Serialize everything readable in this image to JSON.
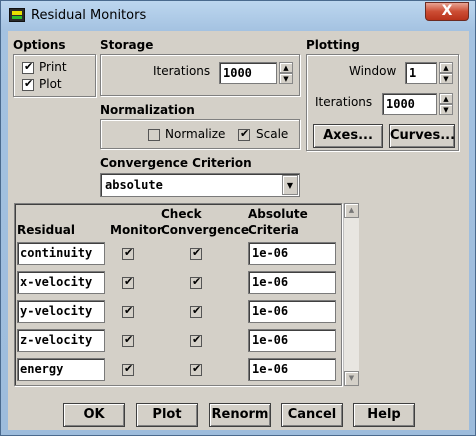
{
  "window": {
    "title": "Residual Monitors",
    "close_label": "X"
  },
  "options": {
    "heading": "Options",
    "print_label": "Print",
    "plot_label": "Plot",
    "print_checked": true,
    "plot_checked": true
  },
  "storage": {
    "heading": "Storage",
    "iterations_label": "Iterations",
    "iterations_value": "1000"
  },
  "plotting": {
    "heading": "Plotting",
    "window_label": "Window",
    "window_value": "1",
    "iterations_label": "Iterations",
    "iterations_value": "1000",
    "axes_button": "Axes...",
    "curves_button": "Curves..."
  },
  "normalization": {
    "heading": "Normalization",
    "normalize_label": "Normalize",
    "normalize_checked": false,
    "scale_label": "Scale",
    "scale_checked": true
  },
  "convergence": {
    "heading": "Convergence Criterion",
    "selected": "absolute"
  },
  "residuals": {
    "col_residual": "Residual",
    "col_monitor": "Monitor",
    "col_check_top": "Check",
    "col_check_bottom": "Convergence",
    "col_abs_top": "Absolute",
    "col_abs_bottom": "Criteria",
    "rows": [
      {
        "name": "continuity",
        "monitor": true,
        "check": true,
        "criteria": "1e-06"
      },
      {
        "name": "x-velocity",
        "monitor": true,
        "check": true,
        "criteria": "1e-06"
      },
      {
        "name": "y-velocity",
        "monitor": true,
        "check": true,
        "criteria": "1e-06"
      },
      {
        "name": "z-velocity",
        "monitor": true,
        "check": true,
        "criteria": "1e-06"
      },
      {
        "name": "energy",
        "monitor": true,
        "check": true,
        "criteria": "1e-06"
      }
    ]
  },
  "buttons": {
    "ok": "OK",
    "plot": "Plot",
    "renorm": "Renorm",
    "cancel": "Cancel",
    "help": "Help"
  }
}
